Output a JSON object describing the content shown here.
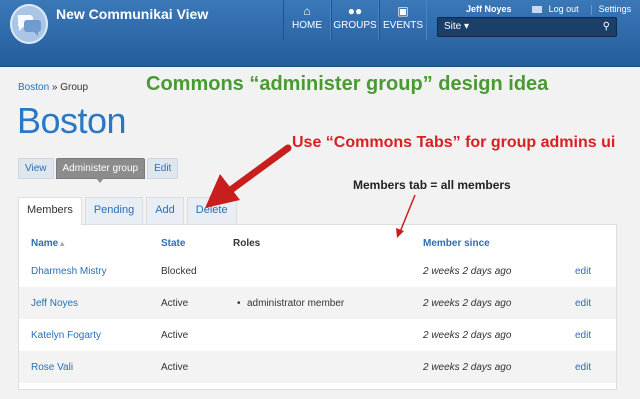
{
  "header": {
    "app_title": "New Communikai View",
    "nav": [
      {
        "label": "HOME",
        "icon": "home-icon",
        "glyph": "⌂"
      },
      {
        "label": "GROUPS",
        "icon": "groups-icon",
        "glyph": "👥"
      },
      {
        "label": "EVENTS",
        "icon": "calendar-icon",
        "glyph": "📅"
      }
    ],
    "user_name": "Jeff Noyes",
    "logout": "Log out",
    "settings": "Settings",
    "search_scope": "Site ▾",
    "search_icon": "search-icon"
  },
  "breadcrumb": {
    "link": "Boston",
    "sep": " » ",
    "current": "Group"
  },
  "page_title": "Boston",
  "annotations": {
    "main": "Commons “administer group” design idea",
    "tabs": "Use “Commons Tabs” for group admins ui",
    "members": "Members tab = all members"
  },
  "primary_tabs": [
    "View",
    "Administer group",
    "Edit"
  ],
  "secondary_tabs": [
    "Members",
    "Pending",
    "Add",
    "Delete"
  ],
  "table": {
    "headers": [
      "Name",
      "State",
      "Roles",
      "Member since",
      ""
    ],
    "rows": [
      {
        "name": "Dharmesh Mistry",
        "state": "Blocked",
        "roles": "",
        "since": "2 weeks 2 days ago",
        "action": "edit"
      },
      {
        "name": "Jeff Noyes",
        "state": "Active",
        "roles": "administrator member",
        "since": "2 weeks 2 days ago",
        "action": "edit"
      },
      {
        "name": "Katelyn Fogarty",
        "state": "Active",
        "roles": "",
        "since": "2 weeks 2 days ago",
        "action": "edit"
      },
      {
        "name": "Rose Vali",
        "state": "Active",
        "roles": "",
        "since": "2 weeks 2 days ago",
        "action": "edit"
      }
    ]
  },
  "colors": {
    "header_blue": "#2f6aa9",
    "link_blue": "#2a6fb6",
    "annotation_green": "#4a9a33",
    "annotation_red": "#d91f1f"
  }
}
